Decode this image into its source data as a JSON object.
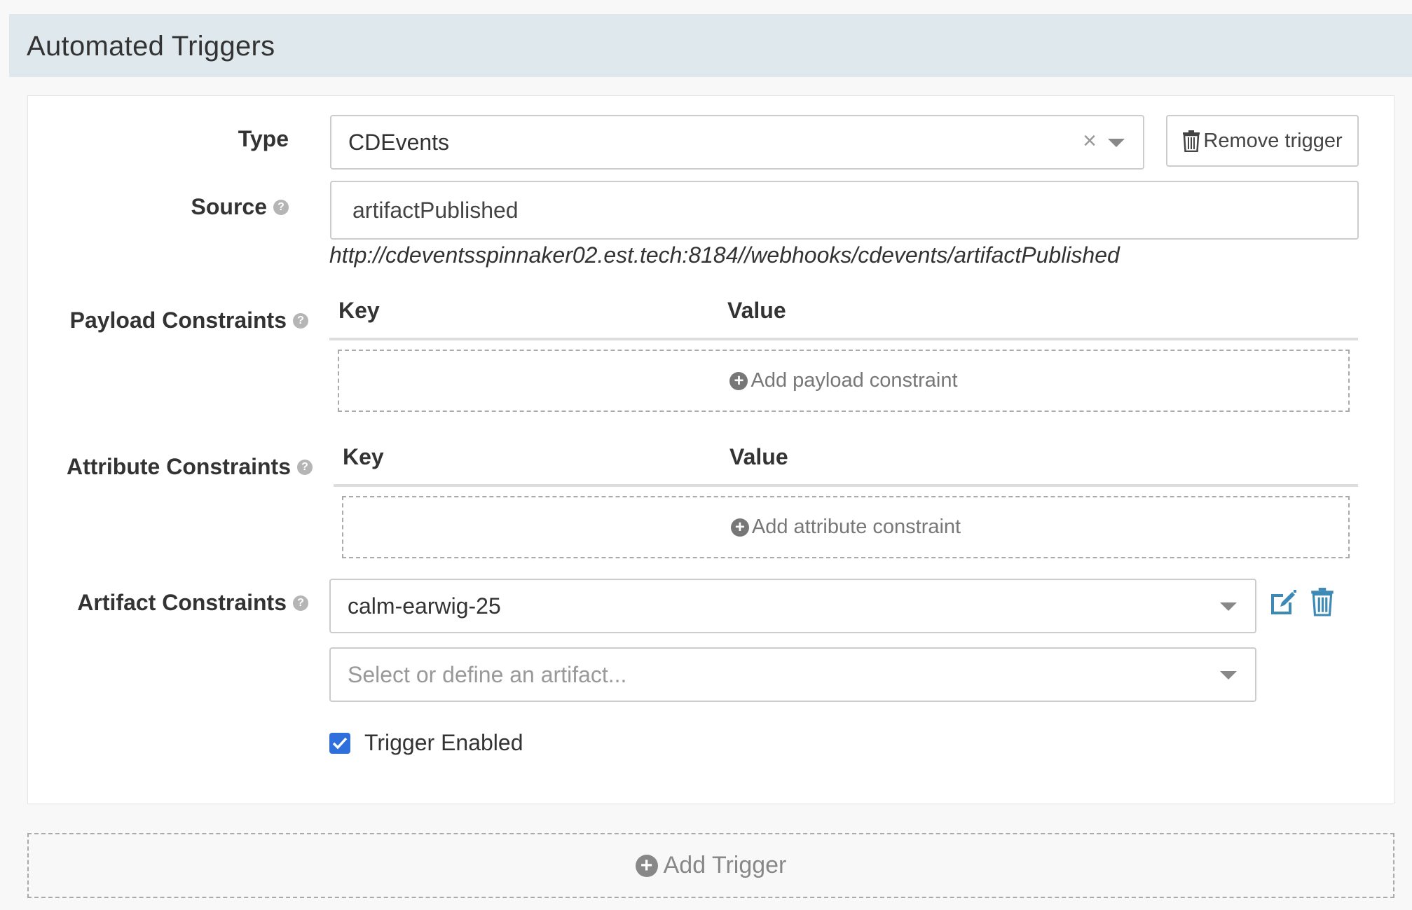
{
  "section": {
    "title": "Automated Triggers"
  },
  "trigger": {
    "type_label": "Type",
    "type_value": "CDEvents",
    "clear_glyph": "×",
    "remove_label": "Remove trigger",
    "source_label": "Source",
    "source_value": "artifactPublished",
    "webhook_url": "http://cdeventsspinnaker02.est.tech:8184//webhooks/cdevents/artifactPublished",
    "payload": {
      "label": "Payload Constraints",
      "key_header": "Key",
      "value_header": "Value",
      "add_label": "Add payload constraint"
    },
    "attribute": {
      "label": "Attribute Constraints",
      "key_header": "Key",
      "value_header": "Value",
      "add_label": "Add attribute constraint"
    },
    "artifact": {
      "label": "Artifact Constraints",
      "selected": "calm-earwig-25",
      "placeholder": "Select or define an artifact..."
    },
    "enabled": {
      "label": "Trigger Enabled",
      "checked": true
    }
  },
  "add_trigger_label": "Add Trigger",
  "help_glyph": "?",
  "plus_glyph": "+",
  "colors": {
    "header_bg": "#dfe8ec",
    "icon_accent": "#3e8ab6",
    "checkbox": "#2f6fdb"
  }
}
